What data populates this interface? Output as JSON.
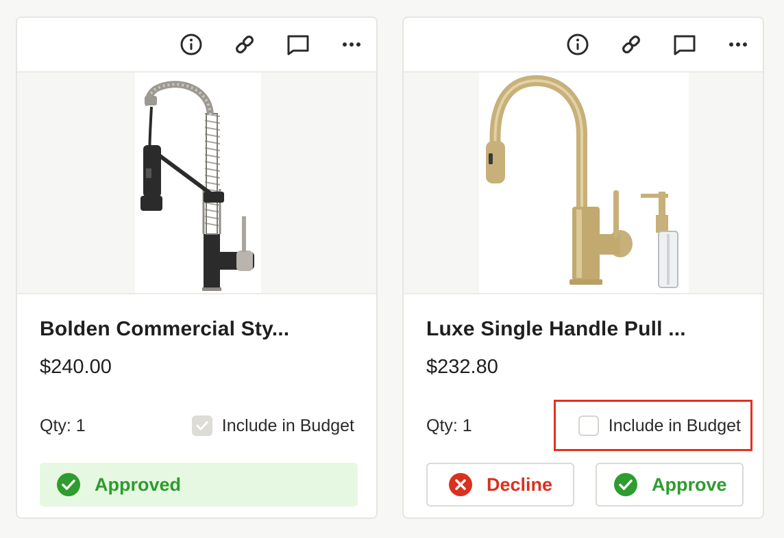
{
  "cards": [
    {
      "name": "Bolden Commercial Sty...",
      "price": "$240.00",
      "qty": "Qty: 1",
      "budget_label": "Include in Budget",
      "budget_checked": true,
      "status": "Approved"
    },
    {
      "name": "Luxe Single Handle Pull ...",
      "price": "$232.80",
      "qty": "Qty: 1",
      "budget_label": "Include in Budget",
      "budget_checked": false,
      "decline_label": "Decline",
      "approve_label": "Approve"
    }
  ],
  "toolbar_icons": [
    "info-icon",
    "link-icon",
    "comment-icon",
    "more-icon"
  ],
  "colors": {
    "approve_green": "#2e9c2e",
    "approved_bg": "#e6f8e1",
    "decline_red": "#d9311f",
    "highlight_red": "#e2301f",
    "faucet_gold": "#c7b07a",
    "faucet_black": "#2b2b2b",
    "faucet_steel": "#a9a59e"
  }
}
